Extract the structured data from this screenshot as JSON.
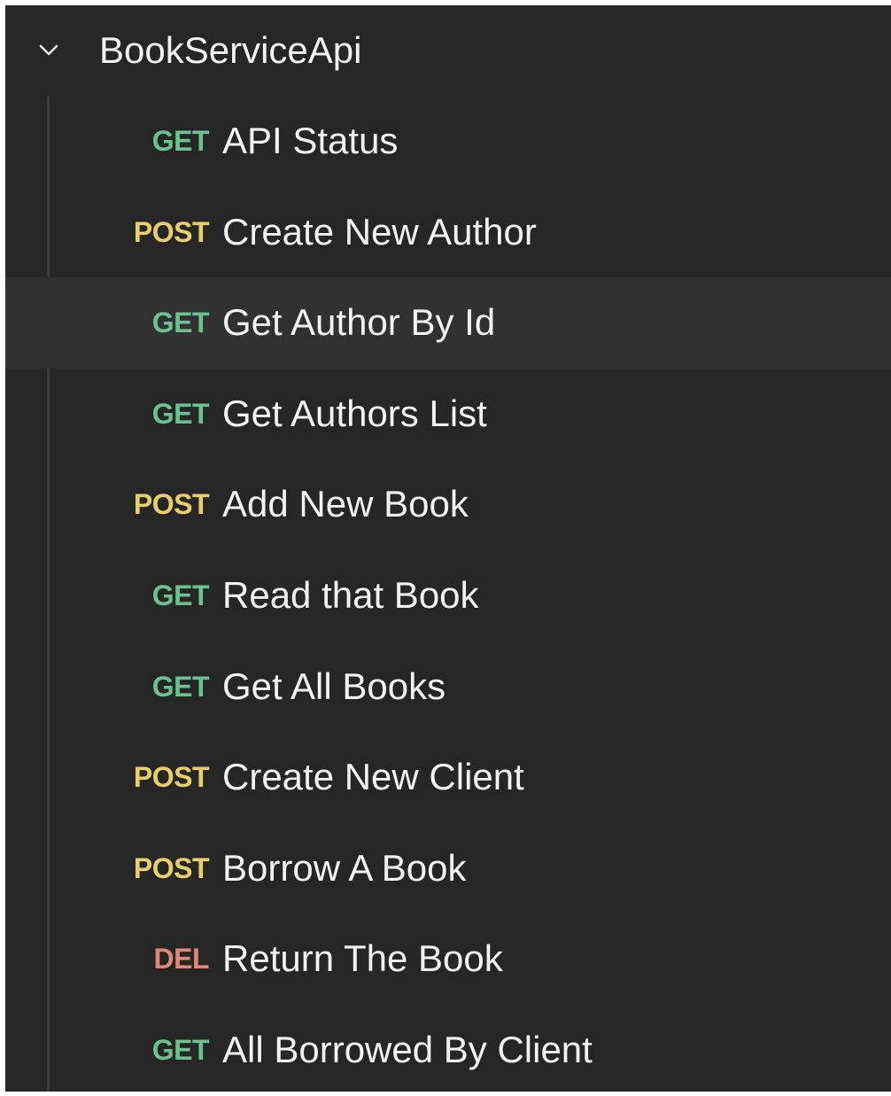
{
  "collection": {
    "name": "BookServiceApi",
    "expanded": true
  },
  "method_colors": {
    "GET": "#6bc28e",
    "POST": "#e8cf6c",
    "DEL": "#e28878"
  },
  "colors": {
    "panel_bg": "#262626",
    "selected_row_bg": "#313131",
    "text": "#f2f2f2"
  },
  "requests": [
    {
      "method": "GET",
      "name": "API Status"
    },
    {
      "method": "POST",
      "name": "Create New Author"
    },
    {
      "method": "GET",
      "name": "Get Author By Id",
      "selected": true
    },
    {
      "method": "GET",
      "name": "Get Authors List"
    },
    {
      "method": "POST",
      "name": "Add New Book"
    },
    {
      "method": "GET",
      "name": "Read that Book"
    },
    {
      "method": "GET",
      "name": "Get All Books"
    },
    {
      "method": "POST",
      "name": "Create New Client"
    },
    {
      "method": "POST",
      "name": "Borrow A Book"
    },
    {
      "method": "DEL",
      "name": "Return The Book"
    },
    {
      "method": "GET",
      "name": "All Borrowed By Client"
    }
  ]
}
